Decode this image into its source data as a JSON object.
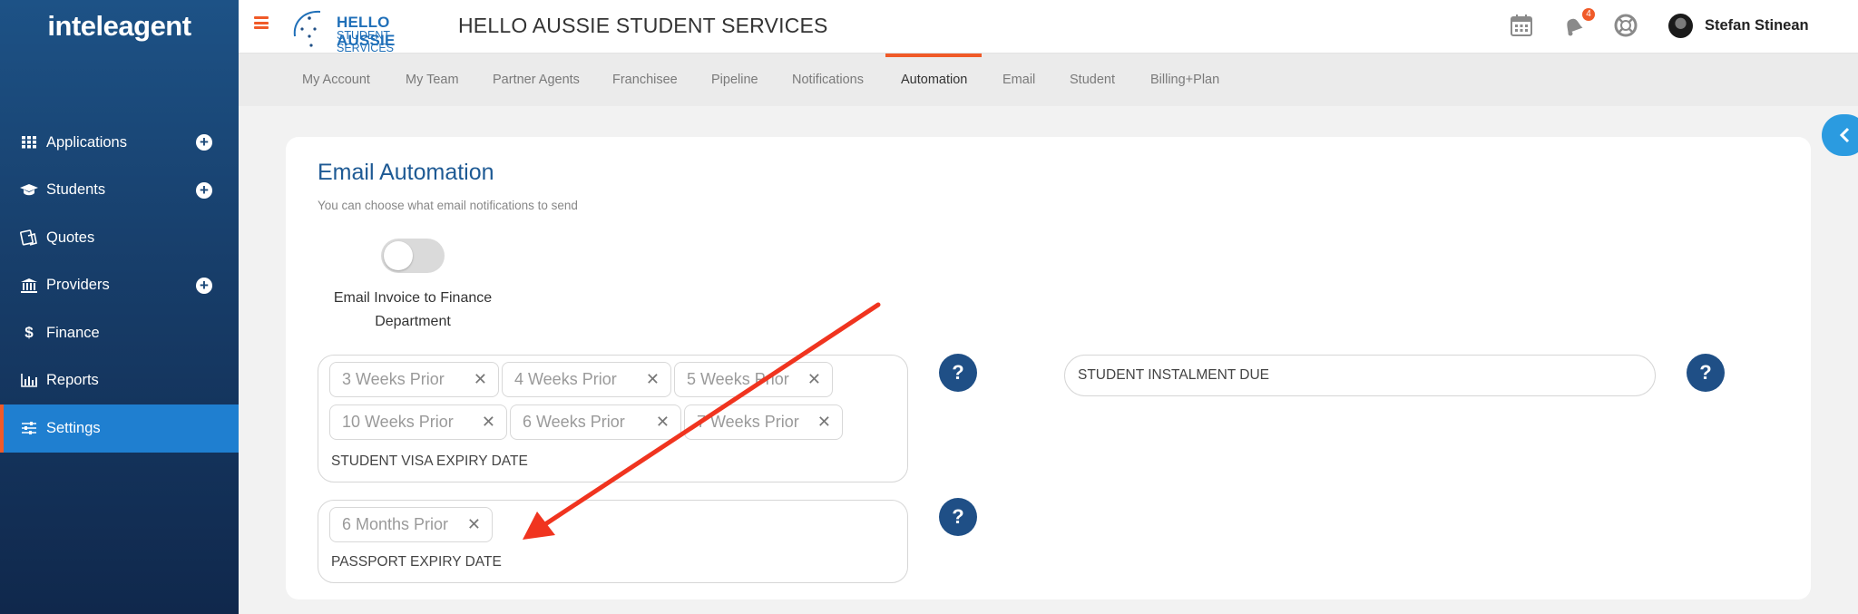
{
  "sidebar": {
    "logo": "inteleagent",
    "items": [
      {
        "label": "Applications",
        "icon": "grid-icon",
        "has_add": true
      },
      {
        "label": "Students",
        "icon": "graduation-cap-icon",
        "has_add": true
      },
      {
        "label": "Quotes",
        "icon": "quotes-icon",
        "has_add": false
      },
      {
        "label": "Providers",
        "icon": "bank-icon",
        "has_add": true
      },
      {
        "label": "Finance",
        "icon": "dollar-icon",
        "has_add": false
      },
      {
        "label": "Reports",
        "icon": "bar-chart-icon",
        "has_add": false
      },
      {
        "label": "Settings",
        "icon": "sliders-icon",
        "has_add": false,
        "active": true
      }
    ],
    "add_symbol": "+"
  },
  "header": {
    "brand_line1": "HELLO AUSSIE",
    "brand_line2": "STUDENT SERVICES",
    "title": "HELLO AUSSIE STUDENT SERVICES",
    "notification_count": "4",
    "user_name": "Stefan Stinean"
  },
  "tabs": [
    {
      "label": "My Account"
    },
    {
      "label": "My Team"
    },
    {
      "label": "Partner Agents"
    },
    {
      "label": "Franchisee"
    },
    {
      "label": "Pipeline"
    },
    {
      "label": "Notifications"
    },
    {
      "label": "Automation",
      "active": true
    },
    {
      "label": "Email"
    },
    {
      "label": "Student"
    },
    {
      "label": "Billing+Plan"
    }
  ],
  "main": {
    "title": "Email Automation",
    "subtitle": "You can choose what email notifications to send",
    "toggle": {
      "label": "Email Invoice to Finance Department",
      "on": false
    },
    "visa_field": {
      "chips": [
        "3 Weeks Prior",
        "4 Weeks Prior",
        "5 Weeks Prior",
        "10 Weeks Prior",
        "6 Weeks Prior",
        "7 Weeks Prior"
      ],
      "label": "STUDENT VISA EXPIRY DATE"
    },
    "passport_field": {
      "chips": [
        "6 Months Prior"
      ],
      "label": "PASSPORT EXPIRY DATE"
    },
    "instalment_field": {
      "value": "STUDENT INSTALMENT DUE"
    },
    "help_symbol": "?",
    "chip_remove_symbol": "✕"
  },
  "annotation": {
    "arrow_color": "#f0341f"
  },
  "colors": {
    "accent": "#f05a28",
    "primary": "#1e5a94",
    "active_nav": "#1f7fd0"
  }
}
